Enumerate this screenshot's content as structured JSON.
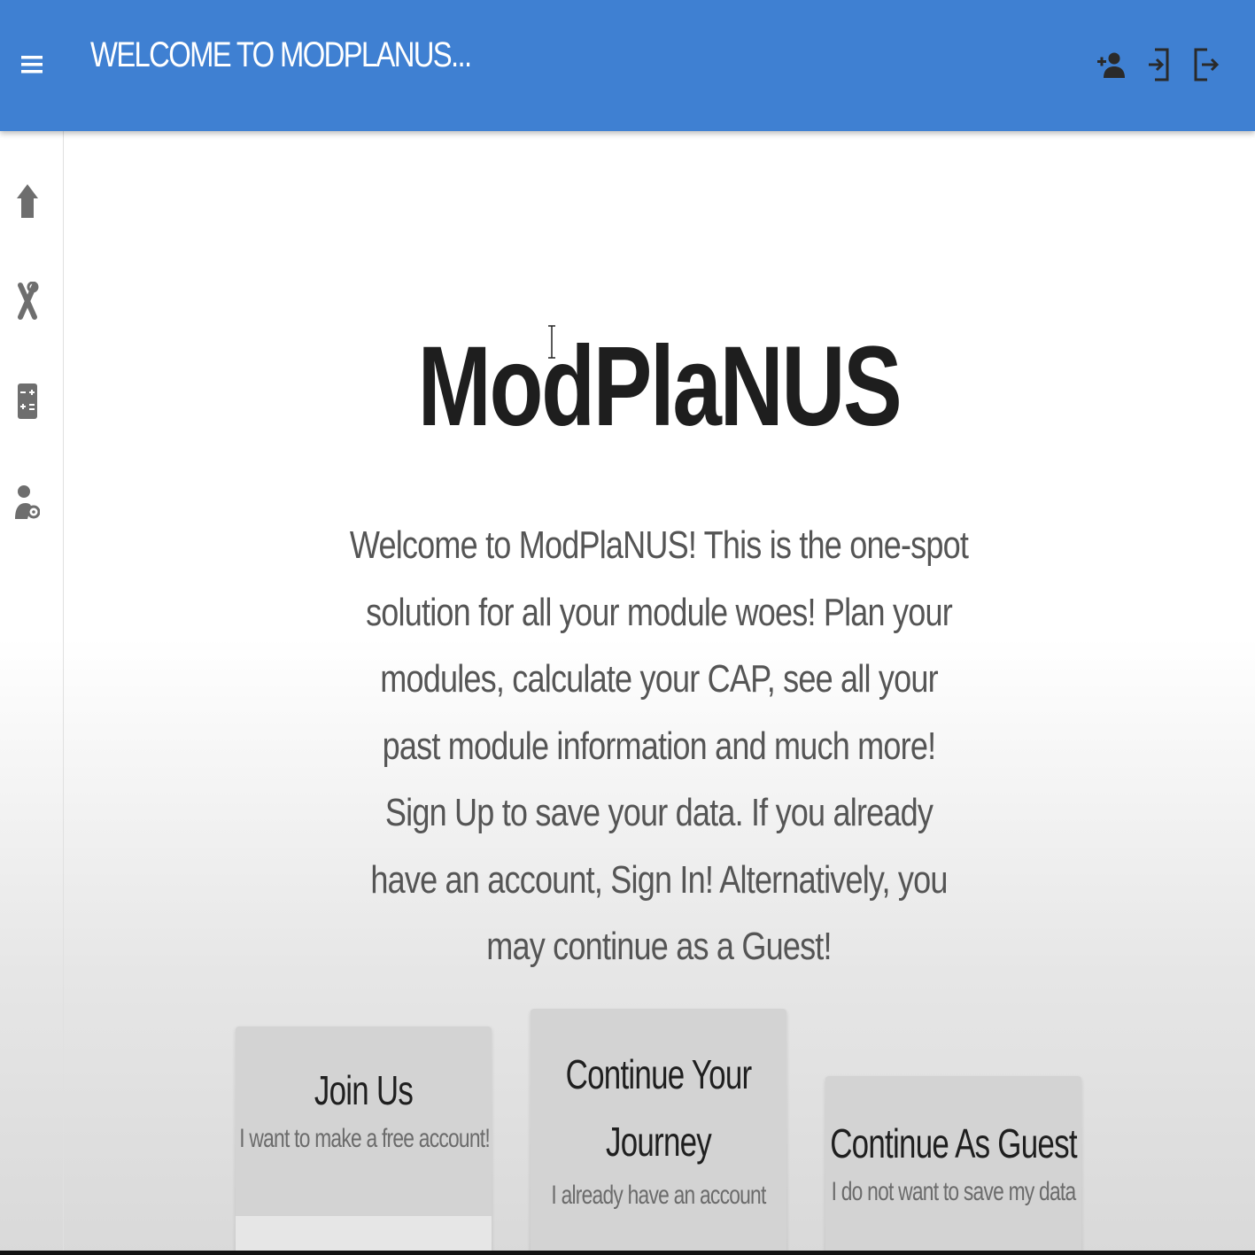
{
  "header": {
    "title": "WELCOME TO MODPLANUS...",
    "menu_icon": "hamburger-menu-icon",
    "actions": [
      {
        "icon": "add-user-icon"
      },
      {
        "icon": "sign-in-icon"
      },
      {
        "icon": "sign-out-icon"
      }
    ],
    "colors": {
      "bar": "#3f80d2",
      "text": "#ffffff"
    }
  },
  "sidebar": {
    "items": [
      {
        "icon": "home-icon"
      },
      {
        "icon": "tools-icon"
      },
      {
        "icon": "calculator-icon"
      },
      {
        "icon": "user-settings-icon"
      }
    ]
  },
  "main": {
    "title": "ModPlaNUS",
    "intro": "Welcome to ModPlaNUS! This is the one-spot solution for all your module woes! Plan your modules, calculate your CAP, see all your past module information and much more! Sign Up to save your data. If you already have an account, Sign In! Alternatively, you may continue as a Guest!"
  },
  "cards": [
    {
      "title": "Join Us",
      "subtitle": "I want to make a free account!"
    },
    {
      "title": "Continue Your Journey",
      "subtitle": "I already have an account"
    },
    {
      "title": "Continue As Guest",
      "subtitle": "I do not want to save my data"
    }
  ]
}
